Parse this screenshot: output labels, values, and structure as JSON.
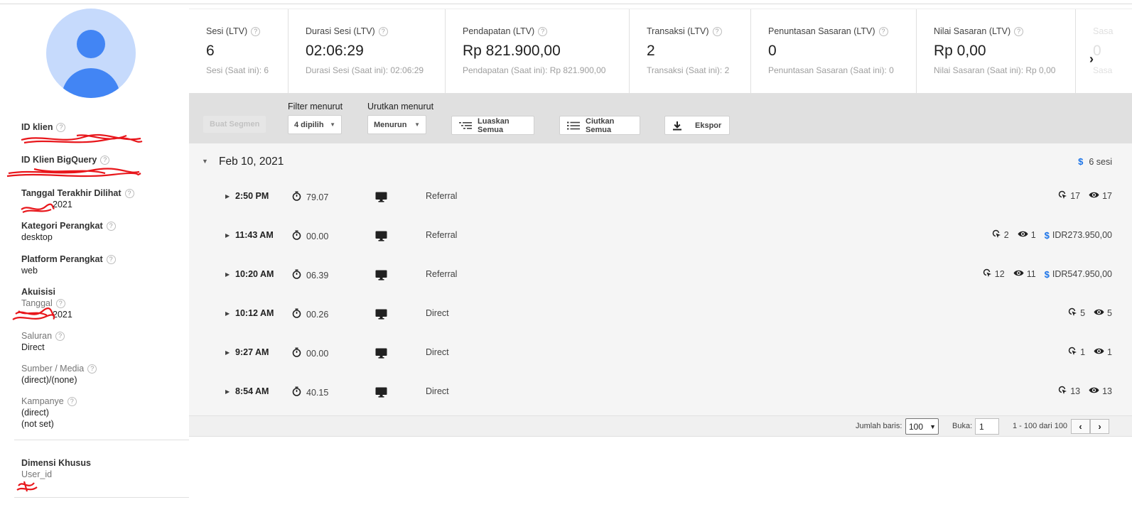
{
  "sidebar": {
    "client_id_label": "ID klien",
    "bigquery_id_label": "ID Klien BigQuery",
    "last_seen_label": "Tanggal Terakhir Dilihat",
    "last_seen_value": "2021",
    "device_category_label": "Kategori Perangkat",
    "device_category_value": "desktop",
    "device_platform_label": "Platform Perangkat",
    "device_platform_value": "web",
    "acquisition_label": "Akuisisi",
    "acq_date_label": "Tanggal",
    "acq_date_value": "2021",
    "channel_label": "Saluran",
    "channel_value": "Direct",
    "source_medium_label": "Sumber / Media",
    "source_medium_value": "(direct)/(none)",
    "campaign_label": "Kampanye",
    "campaign_value_1": "(direct)",
    "campaign_value_2": "(not set)",
    "custom_dims_label": "Dimensi Khusus",
    "user_id_label": "User_id"
  },
  "help_mark": "?",
  "cards": [
    {
      "label": "Sesi (LTV)",
      "value": "6",
      "sub": "Sesi (Saat ini): 6"
    },
    {
      "label": "Durasi Sesi (LTV)",
      "value": "02:06:29",
      "sub": "Durasi Sesi (Saat ini): 02:06:29"
    },
    {
      "label": "Pendapatan (LTV)",
      "value": "Rp 821.900,00",
      "sub": "Pendapatan (Saat ini): Rp 821.900,00"
    },
    {
      "label": "Transaksi (LTV)",
      "value": "2",
      "sub": "Transaksi (Saat ini): 2"
    },
    {
      "label": "Penuntasan Sasaran (LTV)",
      "value": "0",
      "sub": "Penuntasan Sasaran (Saat ini): 0"
    },
    {
      "label": "Nilai Sasaran (LTV)",
      "value": "Rp 0,00",
      "sub": "Nilai Sasaran (Saat ini): Rp 0,00"
    },
    {
      "label": "Sasa",
      "value": "0",
      "sub": "Sasa"
    }
  ],
  "toolbar": {
    "create_segment": "Buat Segmen",
    "filter_label": "Filter menurut",
    "filter_value": "4 dipilih",
    "sort_label": "Urutkan menurut",
    "sort_value": "Menurun",
    "expand_all": "Luaskan Semua",
    "collapse_all": "Ciutkan Semua",
    "export": "Ekspor"
  },
  "session_group": {
    "date": "Feb 10, 2021",
    "count": "6 sesi",
    "currency_symbol": "$"
  },
  "sessions": [
    {
      "time": "2:50 PM",
      "duration": "79.07",
      "channel": "Referral",
      "hits": "17",
      "views": "17",
      "revenue": ""
    },
    {
      "time": "11:43 AM",
      "duration": "00.00",
      "channel": "Referral",
      "hits": "2",
      "views": "1",
      "revenue": "IDR273.950,00"
    },
    {
      "time": "10:20 AM",
      "duration": "06.39",
      "channel": "Referral",
      "hits": "12",
      "views": "11",
      "revenue": "IDR547.950,00"
    },
    {
      "time": "10:12 AM",
      "duration": "00.26",
      "channel": "Direct",
      "hits": "5",
      "views": "5",
      "revenue": ""
    },
    {
      "time": "9:27 AM",
      "duration": "00.00",
      "channel": "Direct",
      "hits": "1",
      "views": "1",
      "revenue": ""
    },
    {
      "time": "8:54 AM",
      "duration": "40.15",
      "channel": "Direct",
      "hits": "13",
      "views": "13",
      "revenue": ""
    }
  ],
  "pager": {
    "rows_label": "Jumlah baris:",
    "rows_value": "100",
    "goto_label": "Buka:",
    "goto_value": "1",
    "range": "1 - 100 dari 100"
  },
  "colors": {
    "accent": "#4285f4",
    "dollar": "#1a73e8",
    "toolbar_bg": "#e0e0e0"
  }
}
